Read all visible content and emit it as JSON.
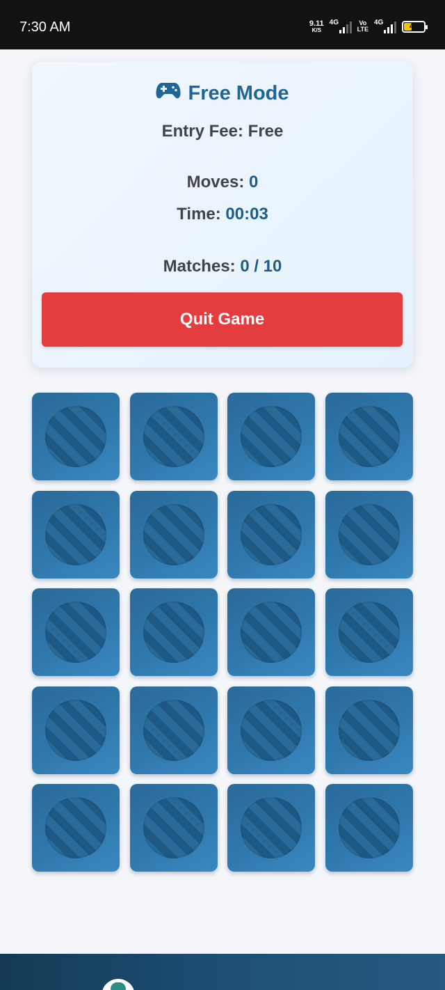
{
  "status_bar": {
    "time": "7:30 AM",
    "net_speed_value": "9.11",
    "net_speed_unit": "K/S",
    "sim1_label": "4G",
    "volte_top": "Vo",
    "volte_bottom": "LTE",
    "sim2_label": "4G",
    "battery_level": "41",
    "battery_color": "#f5c400"
  },
  "game_info": {
    "mode_icon": "gamepad-icon",
    "mode_title": "Free Mode",
    "entry_fee_label": "Entry Fee:",
    "entry_fee_value": "Free",
    "moves_label": "Moves:",
    "moves_value": "0",
    "time_label": "Time:",
    "time_value": "00:03",
    "matches_label": "Matches:",
    "matches_value": "0 / 10",
    "quit_button_label": "Quit Game",
    "quit_button_color": "#e43d40",
    "accent_color": "#1f6596"
  },
  "board": {
    "columns": 4,
    "rows": 5,
    "card_state": "face-down",
    "card_color": "#2f78ad"
  },
  "bottom_bar": {
    "logo_icon": "app-logo-icon"
  }
}
